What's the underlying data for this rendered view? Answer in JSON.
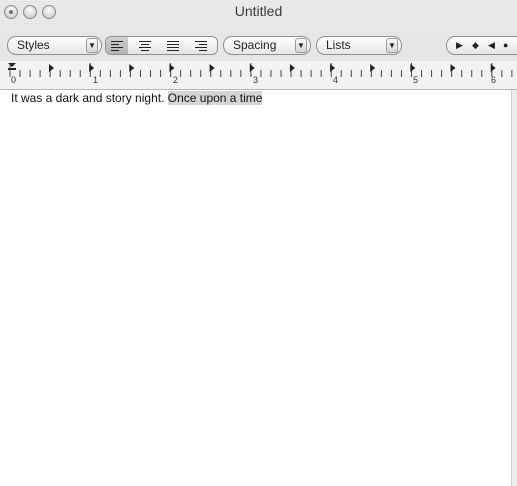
{
  "window": {
    "title": "Untitled"
  },
  "toolbar": {
    "styles_label": "Styles",
    "spacing_label": "Spacing",
    "lists_label": "Lists"
  },
  "ruler": {
    "marks": [
      "0",
      "1",
      "2",
      "3",
      "4",
      "5",
      "6"
    ]
  },
  "document": {
    "text_plain": "It was a dark and story night. ",
    "text_selected": "Once upon a time"
  }
}
